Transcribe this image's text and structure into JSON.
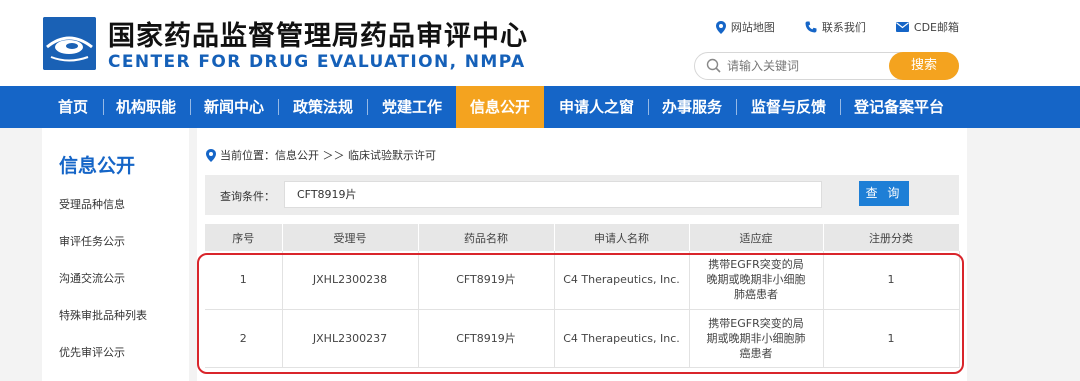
{
  "header": {
    "title_cn": "国家药品监督管理局药品审评中心",
    "title_en": "CENTER FOR DRUG EVALUATION, NMPA",
    "links": [
      {
        "label": "网站地图",
        "icon": "location-pin-icon"
      },
      {
        "label": "联系我们",
        "icon": "phone-icon"
      },
      {
        "label": "CDE邮箱",
        "icon": "mail-icon"
      }
    ],
    "search_placeholder": "请输入关键词",
    "search_button": "搜索"
  },
  "nav": {
    "items": [
      "首页",
      "机构职能",
      "新闻中心",
      "政策法规",
      "党建工作",
      "信息公开",
      "申请人之窗",
      "办事服务",
      "监督与反馈",
      "登记备案平台"
    ],
    "active_index": 5
  },
  "sidebar": {
    "title": "信息公开",
    "items": [
      "受理品种信息",
      "审评任务公示",
      "沟通交流公示",
      "特殊审批品种列表",
      "优先审评公示"
    ]
  },
  "breadcrumb": {
    "text": "当前位置：信息公开 ＞＞ 临床试验默示许可"
  },
  "query": {
    "label": "查询条件：",
    "value": "CFT8919片",
    "button": "查 询"
  },
  "table": {
    "headers": [
      "序号",
      "受理号",
      "药品名称",
      "申请人名称",
      "适应症",
      "注册分类"
    ],
    "rows": [
      [
        "1",
        "JXHL2300238",
        "CFT8919片",
        "C4 Therapeutics, Inc.",
        "携带EGFR突变的局晚期或晚期非小细胞肺癌患者",
        "1"
      ],
      [
        "2",
        "JXHL2300237",
        "CFT8919片",
        "C4 Therapeutics, Inc.",
        "携带EGFR突变的局期或晚期非小细胞肺癌患者",
        "1"
      ]
    ]
  },
  "colors": {
    "primary_blue": "#1565c7",
    "accent_orange": "#f4a31f",
    "highlight_red": "#d9252b"
  }
}
